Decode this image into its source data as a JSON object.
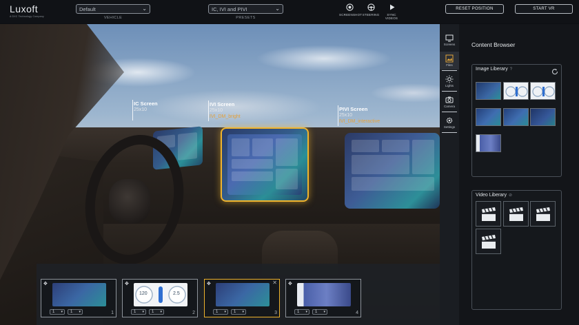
{
  "header": {
    "logo": "Luxoft",
    "logo_tagline": "A DXC Technology Company",
    "vehicle_select": {
      "value": "Default",
      "caption": "VEHICLE"
    },
    "presets_select": {
      "value": "IC, IVI and PIVI",
      "caption": "PRESETS"
    },
    "tools": [
      {
        "label": "SCREENSHOT",
        "icon": "camera-shutter-icon"
      },
      {
        "label": "STEERING",
        "icon": "steering-wheel-icon"
      },
      {
        "label": "SYNC VIDEOS",
        "icon": "play-icon"
      }
    ],
    "reset_button": "RESET POSITION",
    "start_vr_button": "START VR"
  },
  "viewport": {
    "screens": [
      {
        "title": "IC Screen",
        "resolution": "25x10",
        "preset": ""
      },
      {
        "title": "IVI Screen",
        "resolution": "25x10",
        "preset": "IVI_DM_bright"
      },
      {
        "title": "PIVI Screen",
        "resolution": "25x10",
        "preset": "IVI_DM_interactive"
      }
    ],
    "accent_color": "#f0b42d"
  },
  "layouts": [
    {
      "number": "1",
      "select_a": "1",
      "select_b": "1",
      "active": false
    },
    {
      "number": "2",
      "select_a": "1",
      "select_b": "1",
      "active": false,
      "gauge_left": "120",
      "gauge_right": "2.5"
    },
    {
      "number": "3",
      "select_a": "1",
      "select_b": "1",
      "active": true
    },
    {
      "number": "4",
      "select_a": "1",
      "select_b": "1",
      "active": false
    }
  ],
  "rail": [
    {
      "label": "Screens",
      "icon": "monitor-icon",
      "active": false
    },
    {
      "label": "Files",
      "icon": "image-file-icon",
      "active": true
    },
    {
      "label": "Lights",
      "icon": "sun-icon",
      "active": false
    },
    {
      "label": "Camera",
      "icon": "camera-icon",
      "active": false
    },
    {
      "label": "Settings",
      "icon": "gear-icon",
      "active": false
    }
  ],
  "content_browser": {
    "title": "Content Browser",
    "image_library": {
      "title": "Image Liberary",
      "help": "?",
      "count": 7
    },
    "video_library": {
      "title": "Video Liberary",
      "help": "⊘",
      "count": 4
    }
  }
}
